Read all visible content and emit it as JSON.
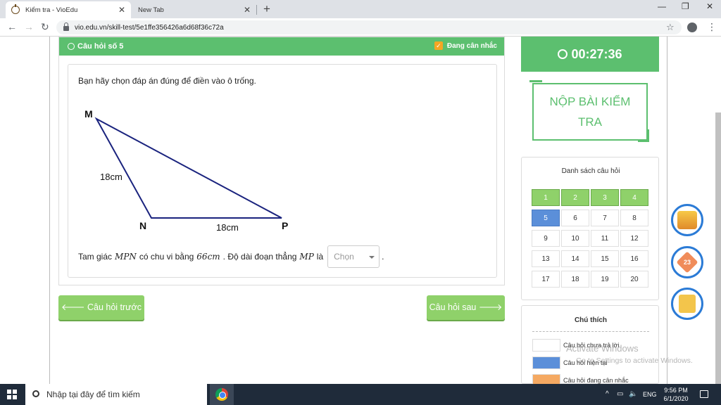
{
  "browser": {
    "tabs": [
      {
        "label": "Kiểm tra - VioEdu",
        "active": true
      },
      {
        "label": "New Tab",
        "active": false
      }
    ],
    "new_tab": "+",
    "url": "vio.edu.vn/skill-test/5e1ffe356426a6d68f36c72a",
    "window": {
      "minimize": "—",
      "restore": "❐",
      "close": "✕"
    }
  },
  "question": {
    "header": "Câu hỏi số 5",
    "flag_label": "Đang cân nhắc",
    "prompt": "Bạn hãy chọn đáp án đúng để điền vào ô trống.",
    "figure": {
      "vertex_m": "M",
      "vertex_n": "N",
      "vertex_p": "P",
      "side_mn": "18cm",
      "side_np": "18cm"
    },
    "sentence": {
      "part1": "Tam giác",
      "math1": "MPN",
      "part2": "có chu vi bằng",
      "math2": "66cm",
      "part3": ". Độ dài đoạn thẳng",
      "math3": "MP",
      "part4": "là",
      "end": "."
    },
    "dropdown": {
      "selected": "Chọn"
    }
  },
  "navigation": {
    "prev": "🡐 Câu hỏi trước",
    "next": "Câu hỏi sau 🡒"
  },
  "timer": "00:27:36",
  "submit_label": "NỘP BÀI KIỂM TRA",
  "question_list": {
    "title": "Danh sách câu hỏi",
    "items": [
      {
        "n": "1",
        "state": "answered"
      },
      {
        "n": "2",
        "state": "answered"
      },
      {
        "n": "3",
        "state": "answered"
      },
      {
        "n": "4",
        "state": "answered"
      },
      {
        "n": "5",
        "state": "current"
      },
      {
        "n": "6",
        "state": "none"
      },
      {
        "n": "7",
        "state": "none"
      },
      {
        "n": "8",
        "state": "none"
      },
      {
        "n": "9",
        "state": "none"
      },
      {
        "n": "10",
        "state": "none"
      },
      {
        "n": "11",
        "state": "none"
      },
      {
        "n": "12",
        "state": "none"
      },
      {
        "n": "13",
        "state": "none"
      },
      {
        "n": "14",
        "state": "none"
      },
      {
        "n": "15",
        "state": "none"
      },
      {
        "n": "16",
        "state": "none"
      },
      {
        "n": "17",
        "state": "none"
      },
      {
        "n": "18",
        "state": "none"
      },
      {
        "n": "19",
        "state": "none"
      },
      {
        "n": "20",
        "state": "none"
      }
    ]
  },
  "legend": {
    "title": "Chú thích",
    "items": [
      {
        "label": "Câu hỏi chưa trả lời",
        "color": "#ffffff"
      },
      {
        "label": "Câu hỏi hiện tại",
        "color": "#5b8fd9"
      },
      {
        "label": "Câu hỏi đang cân nhắc",
        "color": "#f5a962"
      }
    ]
  },
  "watermark": {
    "line1": "Activate Windows",
    "line2": "Go to Settings to activate Windows."
  },
  "taskbar": {
    "search_placeholder": "Nhập tại đây để tìm kiếm",
    "lang": "ENG",
    "time": "9:56 PM",
    "date": "6/1/2020"
  },
  "colors": {
    "accent_green": "#5cbf6f",
    "button_green": "#8fd16a",
    "current_blue": "#5b8fd9",
    "flag_orange": "#f5a623",
    "triangle_navy": "#1a237e"
  },
  "side_icons": [
    "trophy-icon",
    "diamond-badge-icon",
    "scroll-icon"
  ],
  "side_badge": "23"
}
